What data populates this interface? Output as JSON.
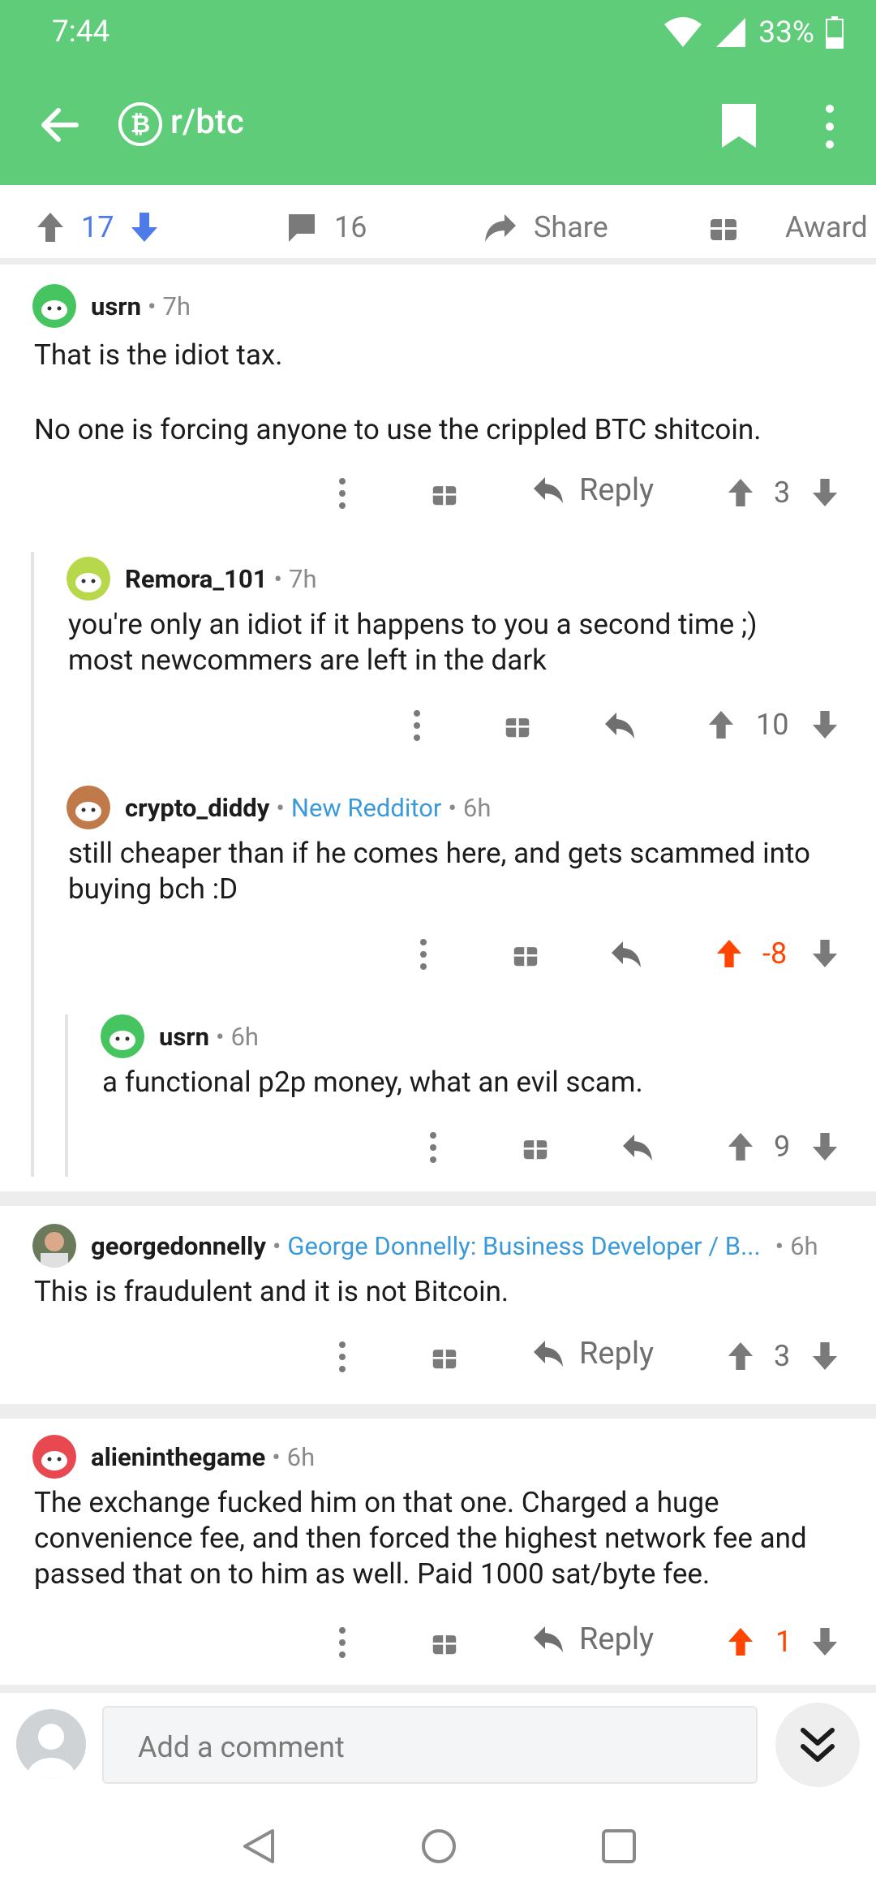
{
  "status": {
    "time": "7:44",
    "battery": "33%"
  },
  "appbar": {
    "subreddit": "r/btc",
    "sub_icon": "₿"
  },
  "post_actions": {
    "score": "17",
    "comments": "16",
    "share": "Share",
    "award": "Award"
  },
  "comments": [
    {
      "user": "usrn",
      "age": "7h",
      "line1": "That is the idiot tax.",
      "line2": "No one is forcing anyone to use the crippled BTC shitcoin.",
      "reply": "Reply",
      "score": "3"
    },
    {
      "user": "Remora_101",
      "age": "7h",
      "line1": "you're only an idiot if it happens to you a second time ;)",
      "line2": "most newcommers are left in the dark",
      "score": "10"
    },
    {
      "user": "crypto_diddy",
      "flair": "New Redditor",
      "age": "6h",
      "line1": "still cheaper than if he comes here, and gets scammed into",
      "line2": "buying bch :D",
      "score": "-8"
    },
    {
      "user": "usrn",
      "age": "6h",
      "line1": "a functional p2p money, what an evil scam.",
      "score": "9"
    },
    {
      "user": "georgedonnelly",
      "flair": "George Donnelly: Business Developer / B...",
      "age": "6h",
      "line1": "This is fraudulent and it is not Bitcoin.",
      "reply": "Reply",
      "score": "3"
    },
    {
      "user": "alieninthegame",
      "age": "6h",
      "line1": "The exchange fucked him on that one. Charged a huge",
      "line2": "convenience fee, and then forced the highest network fee and",
      "line3": "passed that on to him as well. Paid 1000 sat/byte fee.",
      "reply": "Reply",
      "score": "1"
    }
  ],
  "compose": {
    "placeholder": "Add a comment"
  },
  "colors": {
    "header": "#5ecc78",
    "upvote": "#ff4500",
    "accent": "#4e7be8",
    "flair": "#3a9ad9"
  }
}
